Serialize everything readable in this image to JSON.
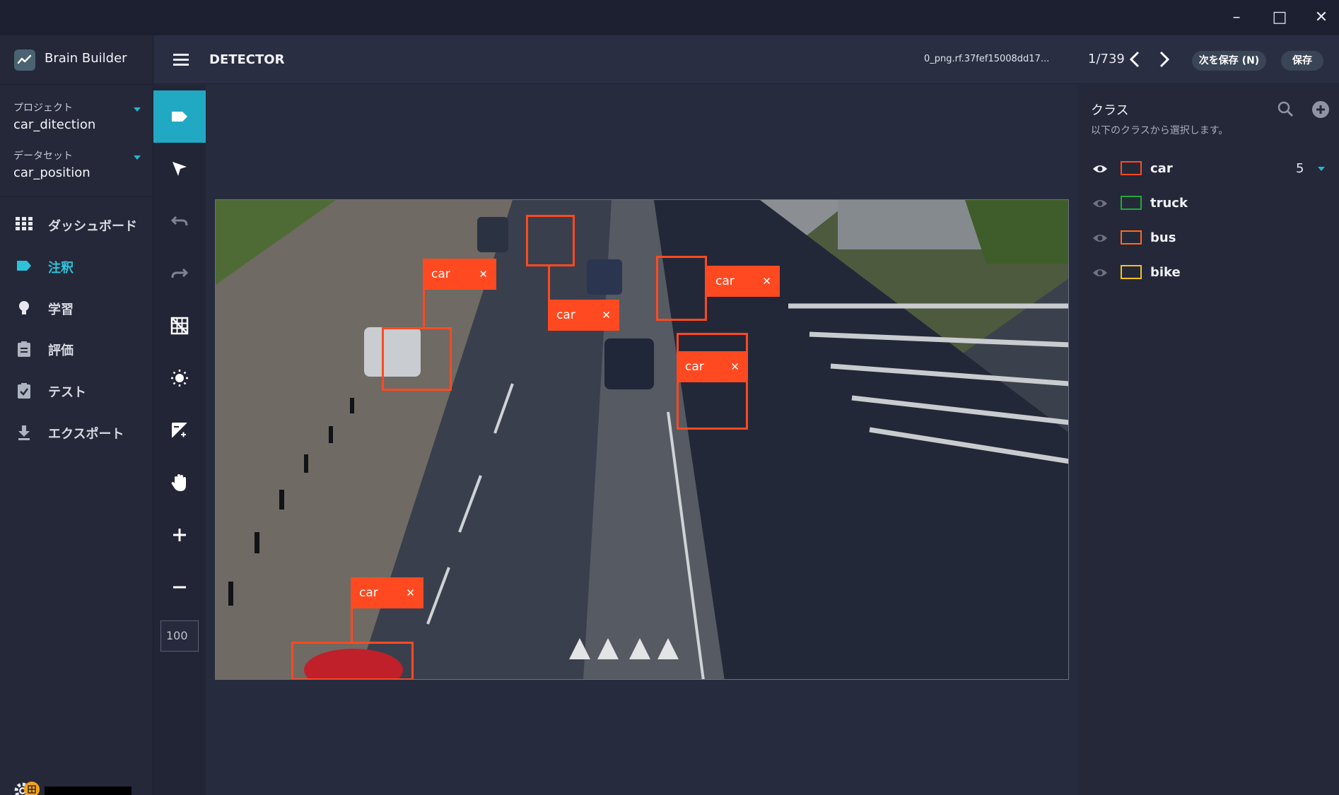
{
  "app": {
    "brand": "Brain Builder",
    "window_controls": {
      "minimize": "–",
      "maximize": "□",
      "close": "✕"
    }
  },
  "sidebar": {
    "project": {
      "label": "プロジェクト",
      "value": "car_ditection"
    },
    "dataset": {
      "label": "データセット",
      "value": "car_position"
    },
    "nav": [
      {
        "label": "ダッシュボード",
        "icon": "grid-icon",
        "active": false
      },
      {
        "label": "注釈",
        "icon": "label-tag-icon",
        "active": true
      },
      {
        "label": "学習",
        "icon": "lightbulb-icon",
        "active": false
      },
      {
        "label": "評価",
        "icon": "clipboard-icon",
        "active": false
      },
      {
        "label": "テスト",
        "icon": "clipboard-check-icon",
        "active": false
      },
      {
        "label": "エクスポート",
        "icon": "download-icon",
        "active": false
      }
    ]
  },
  "header": {
    "title": "DETECTOR",
    "filename": "0_png.rf.37fef15008dd17...",
    "counter": "1/739",
    "save_next_label": "次を保存 (N)",
    "save_label": "保存"
  },
  "toolbar": {
    "tools": [
      "label-tool-icon",
      "pointer-icon",
      "undo-icon",
      "redo-icon",
      "grid-toggle-icon",
      "brightness-icon",
      "contrast-icon",
      "pan-hand-icon",
      "zoom-in-icon",
      "zoom-out-icon"
    ],
    "zoom_value": "100"
  },
  "annotations": [
    {
      "label": "car"
    },
    {
      "label": "car"
    },
    {
      "label": "car"
    },
    {
      "label": "car"
    },
    {
      "label": "car"
    }
  ],
  "classes_panel": {
    "title": "クラス",
    "subtitle": "以下のクラスから選択します。",
    "classes": [
      {
        "name": "car",
        "color": "#ff4a21",
        "count": "5"
      },
      {
        "name": "truck",
        "color": "#21a83a",
        "count": ""
      },
      {
        "name": "bus",
        "color": "#ff6a1f",
        "count": ""
      },
      {
        "name": "bike",
        "color": "#f2c21f",
        "count": ""
      }
    ]
  },
  "colors": {
    "accent": "#21a8c3",
    "annotation": "#ff4a21",
    "badge": "#f2a31f"
  }
}
